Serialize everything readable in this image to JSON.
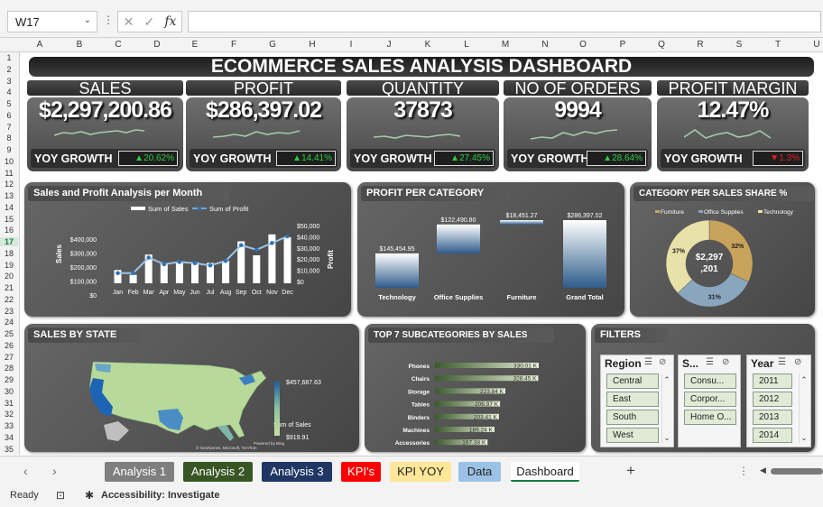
{
  "formula_bar": {
    "name_box": "W17",
    "cancel": "✕",
    "enter": "✓",
    "fx": "fx",
    "formula": ""
  },
  "columns": [
    "A",
    "B",
    "C",
    "D",
    "E",
    "F",
    "G",
    "H",
    "I",
    "J",
    "K",
    "L",
    "M",
    "N",
    "O",
    "P",
    "Q",
    "R",
    "S",
    "T",
    "U"
  ],
  "rows": [
    "1",
    "2",
    "3",
    "4",
    "5",
    "6",
    "7",
    "8",
    "9",
    "10",
    "11",
    "12",
    "13",
    "14",
    "15",
    "16",
    "17",
    "18",
    "19",
    "20",
    "21",
    "22",
    "23",
    "24",
    "25",
    "26",
    "27",
    "28",
    "29",
    "30",
    "31",
    "32",
    "33",
    "34",
    "35"
  ],
  "selected_row": "17",
  "dashboard": {
    "title": "ECOMMERCE SALES ANALYSIS DASHBOARD",
    "kpis": [
      {
        "label": "SALES",
        "value": "$2,297,200.86",
        "yoy_label": "YOY GROWTH",
        "yoy": "▲20.62%",
        "yoy_color": "#2ecc40"
      },
      {
        "label": "PROFIT",
        "value": "$286,397.02",
        "yoy_label": "YOY GROWTH",
        "yoy": "▲14.41%",
        "yoy_color": "#2ecc40"
      },
      {
        "label": "QUANTITY",
        "value": "37873",
        "yoy_label": "YOY GROWTH",
        "yoy": "▲27.45%",
        "yoy_color": "#2ecc40"
      },
      {
        "label": "NO OF ORDERS",
        "value": "9994",
        "yoy_label": "YOY GROWTH",
        "yoy": "▲28.64%",
        "yoy_color": "#2ecc40"
      },
      {
        "label": "PROFIT MARGIN",
        "value": "12.47%",
        "yoy_label": "YOY GROWTH",
        "yoy": "▼1.3%",
        "yoy_color": "#e02020"
      }
    ],
    "monthly": {
      "title": "Sales  and Profit Analysis per Month",
      "legend_sales": "Sum of Sales",
      "legend_profit": "Sum of Profit",
      "ylabel_left": "Sales",
      "ylabel_right": "Profit",
      "left_ticks": [
        "$400,000",
        "$300,000",
        "$200,000",
        "$100,000",
        "$0"
      ],
      "right_ticks": [
        "$50,000",
        "$40,000",
        "$30,000",
        "$20,000",
        "$10,000",
        "$0"
      ]
    },
    "profit_category": {
      "title": "PROFIT PER CATEGORY"
    },
    "category_share": {
      "title": "CATEGORY PER SALES SHARE %",
      "center_line1": "$2,297",
      "center_line2": ",201",
      "colors": [
        "#c9a35a",
        "#8aa6bf",
        "#e8e1a8"
      ]
    },
    "sales_by_state": {
      "title": "SALES BY STATE",
      "legend_title": "Sum of Sales",
      "legend_max": "$457,687.63",
      "legend_min": "$919.91",
      "credit1": "Powered by Bing",
      "credit2": "© GeoNames, Microsoft, TomTom"
    },
    "subcategories": {
      "title": "TOP 7 SUBCATEGORIES BY SALES"
    },
    "filters": {
      "title": "FILTERS",
      "region": {
        "header": "Region",
        "items": [
          "Central",
          "East",
          "South",
          "West"
        ]
      },
      "segment": {
        "header": "S...",
        "items": [
          "Consu...",
          "Corpor...",
          "Home O..."
        ]
      },
      "year": {
        "header": "Year",
        "items": [
          "2011",
          "2012",
          "2013",
          "2014"
        ]
      }
    }
  },
  "chart_data": [
    {
      "type": "bar",
      "title": "Sales  and Profit Analysis per Month",
      "categories": [
        "Jan",
        "Feb",
        "Mar",
        "Apr",
        "May",
        "Jun",
        "Jul",
        "Aug",
        "Sep",
        "Oct",
        "Nov",
        "Dec"
      ],
      "series": [
        {
          "name": "Sum of Sales",
          "type": "bar",
          "values": [
            95000,
            60000,
            205000,
            140000,
            155000,
            150000,
            145000,
            160000,
            300000,
            200000,
            350000,
            330000
          ]
        },
        {
          "name": "Sum of Profit",
          "type": "line",
          "values": [
            9000,
            9000,
            23000,
            17000,
            19000,
            18000,
            16000,
            20000,
            34000,
            30000,
            36000,
            42000
          ]
        }
      ],
      "ylabel": "Sales",
      "ylim": [
        0,
        400000
      ],
      "y2label": "Profit",
      "y2lim": [
        0,
        50000
      ]
    },
    {
      "type": "bar",
      "title": "PROFIT PER CATEGORY",
      "categories": [
        "Technology",
        "Office Supplies",
        "Furniture",
        "Grand Total"
      ],
      "values": [
        145454.95,
        122490.8,
        18451.27,
        286397.02
      ],
      "labels": [
        "$145,454.95",
        "$122,490.80",
        "$18,451.27",
        "$286,397.02"
      ]
    },
    {
      "type": "pie",
      "title": "CATEGORY PER SALES SHARE %",
      "categories": [
        "Furniture",
        "Office Supplies",
        "Technology"
      ],
      "values": [
        32,
        31,
        37
      ],
      "labels": [
        "32%",
        "31%",
        "37%"
      ]
    },
    {
      "type": "bar",
      "title": "TOP 7 SUBCATEGORIES BY SALES",
      "categories": [
        "Phones",
        "Chairs",
        "Storage",
        "Tables",
        "Binders",
        "Machines",
        "Accessories"
      ],
      "values": [
        330.01,
        328.45,
        223.84,
        206.97,
        203.41,
        189.24,
        167.38
      ],
      "labels": [
        "330.01 K",
        "328.45 K",
        "223.84 K",
        "206.97 K",
        "203.41 K",
        "189.24 K",
        "167.38 K"
      ]
    }
  ],
  "sheet_tabs": [
    {
      "label": "Analysis 1",
      "bg": "#7f7f7f",
      "fg": "#ffffff"
    },
    {
      "label": "Analysis 2",
      "bg": "#375623",
      "fg": "#ffffff"
    },
    {
      "label": "Analysis 3",
      "bg": "#203764",
      "fg": "#ffffff"
    },
    {
      "label": "KPI's",
      "bg": "#ff0000",
      "fg": "#ffffff"
    },
    {
      "label": "KPI YOY",
      "bg": "#ffe699",
      "fg": "#222222"
    },
    {
      "label": "Data",
      "bg": "#9bc2e6",
      "fg": "#222222"
    },
    {
      "label": "Dashboard",
      "bg": "#ffffff",
      "fg": "#222222"
    }
  ],
  "add_sheet": "+",
  "status": {
    "ready": "Ready",
    "accessibility": "Accessibility: Investigate"
  }
}
